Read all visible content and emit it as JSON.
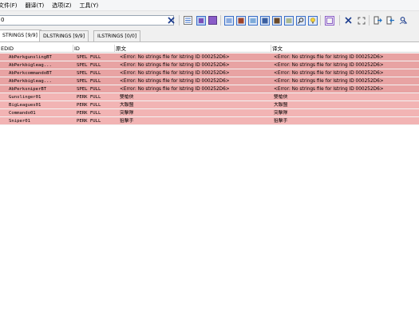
{
  "menu": [
    {
      "label": "文件(F)"
    },
    {
      "label": "翻译(T)"
    },
    {
      "label": "选项(Z)"
    },
    {
      "label": "工具(Y)"
    }
  ],
  "search": {
    "value": "0"
  },
  "colors": {
    "error_row": "#e8a3a3",
    "normal_row": "#f2b4b4",
    "accent_purple": "#7b4fb8",
    "accent_blue": "#3a6fc8"
  },
  "tabs": [
    {
      "label": "STRINGS [9/9]",
      "active": true
    },
    {
      "label": "DLSTRINGS [9/9]",
      "active": false
    },
    {
      "label": "ILSTRINGS [0/0]",
      "active": false
    }
  ],
  "grid": {
    "headers": {
      "edid": "EDID",
      "id": "ID",
      "source": "原文",
      "translation": "译文"
    },
    "rows": [
      {
        "edid": "AbPerkgunslingBT",
        "id": "SPEL FULL",
        "source": "<Error: No strings file for lstring ID 000252D6>",
        "translation": "<Error: No strings file for lstring ID 000252D6>",
        "status": "error"
      },
      {
        "edid": "AbPerkbigleag...",
        "id": "SPEL FULL",
        "source": "<Error: No strings file for lstring ID 000252D6>",
        "translation": "<Error: No strings file for lstring ID 000252D6>",
        "status": "error"
      },
      {
        "edid": "AbPerkcommandoBT",
        "id": "SPEL FULL",
        "source": "<Error: No strings file for lstring ID 000252D6>",
        "translation": "<Error: No strings file for lstring ID 000252D6>",
        "status": "error"
      },
      {
        "edid": "AbPerkbigleag...",
        "id": "SPEL FULL",
        "source": "<Error: No strings file for lstring ID 000252D6>",
        "translation": "<Error: No strings file for lstring ID 000252D6>",
        "status": "error"
      },
      {
        "edid": "AbPerksniperBT",
        "id": "SPEL FULL",
        "source": "<Error: No strings file for lstring ID 000252D6>",
        "translation": "<Error: No strings file for lstring ID 000252D6>",
        "status": "error"
      },
      {
        "edid": "Gunslinger01",
        "id": "PERK FULL",
        "source": "雙槍俠",
        "translation": "雙槍俠",
        "status": "normal"
      },
      {
        "edid": "BigLeagues01",
        "id": "PERK FULL",
        "source": "大聯盟",
        "translation": "大聯盟",
        "status": "normal"
      },
      {
        "edid": "Commando01",
        "id": "PERK FULL",
        "source": "突擊隊",
        "translation": "突擊隊",
        "status": "normal"
      },
      {
        "edid": "Sniper01",
        "id": "PERK FULL",
        "source": "狙擊手",
        "translation": "狙擊手",
        "status": "normal"
      }
    ]
  },
  "toolbar_icons": [
    "clear-search-icon",
    "list-view-icon",
    "highlight-box-icon",
    "purple-box-icon",
    "view-1-icon",
    "view-2-icon",
    "view-3-icon",
    "view-4-icon",
    "view-5-icon",
    "view-6-icon",
    "find-icon",
    "lightbulb-icon",
    "square-frame-icon",
    "close-icon",
    "fullscreen-icon",
    "export-icon",
    "import-icon",
    "user-search-icon"
  ]
}
